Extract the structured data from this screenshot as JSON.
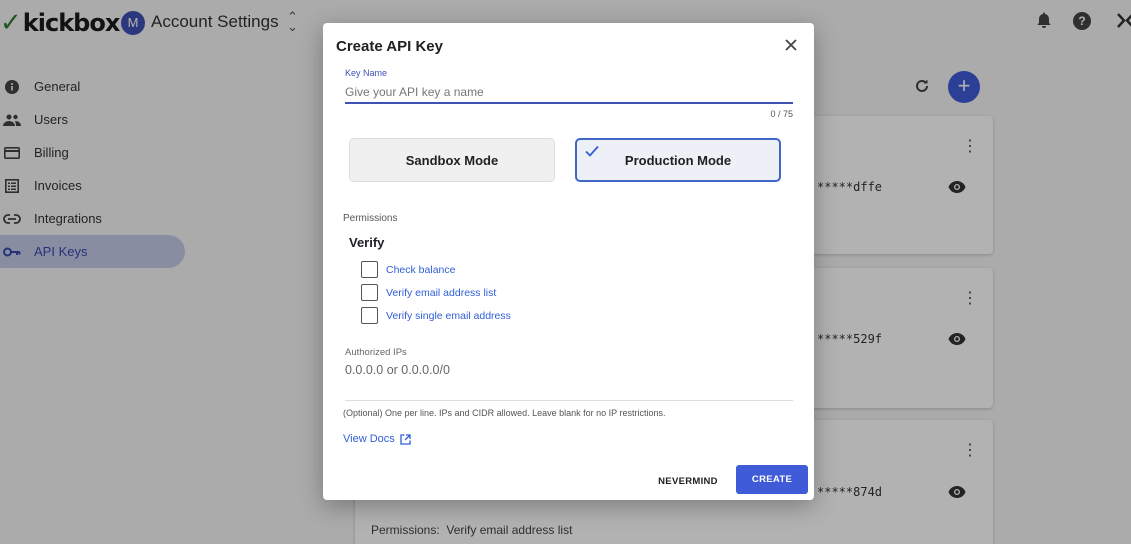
{
  "app": {
    "logo_text": "kickbox",
    "org_initial": "M",
    "title": "Account Settings"
  },
  "sidebar": {
    "items": [
      {
        "label": "General",
        "icon": "info-icon"
      },
      {
        "label": "Users",
        "icon": "users-icon"
      },
      {
        "label": "Billing",
        "icon": "credit-card-icon"
      },
      {
        "label": "Invoices",
        "icon": "list-icon"
      },
      {
        "label": "Integrations",
        "icon": "link-icon"
      },
      {
        "label": "API Keys",
        "icon": "key-icon",
        "active": true
      }
    ]
  },
  "keys": [
    {
      "masked": "*****dffe"
    },
    {
      "masked": "*****529f"
    },
    {
      "masked": "*****874d",
      "permissions_label": "Permissions:",
      "permissions_value": "Verify email address list"
    }
  ],
  "dialog": {
    "title": "Create API Key",
    "key_name_label": "Key Name",
    "key_name_placeholder": "Give your API key a name",
    "key_name_value": "",
    "counter": "0 / 75",
    "modes": [
      {
        "label": "Sandbox Mode",
        "selected": false
      },
      {
        "label": "Production Mode",
        "selected": true
      }
    ],
    "permissions_label": "Permissions",
    "group_title": "Verify",
    "permissions": [
      {
        "label": "Check balance",
        "checked": false
      },
      {
        "label": "Verify email address list",
        "checked": false
      },
      {
        "label": "Verify single email address",
        "checked": false
      }
    ],
    "ips_label": "Authorized IPs",
    "ips_placeholder": "0.0.0.0 or 0.0.0.0/0",
    "ips_help": "(Optional) One per line. IPs and CIDR allowed. Leave blank for no IP restrictions.",
    "docs_link": "View Docs",
    "cancel_label": "NEVERMIND",
    "submit_label": "CREATE"
  },
  "colors": {
    "primary": "#3f5bd8",
    "active_nav_bg": "#c5cae9",
    "link": "#2f5ed6",
    "logo_mark": "#2e7d32"
  }
}
